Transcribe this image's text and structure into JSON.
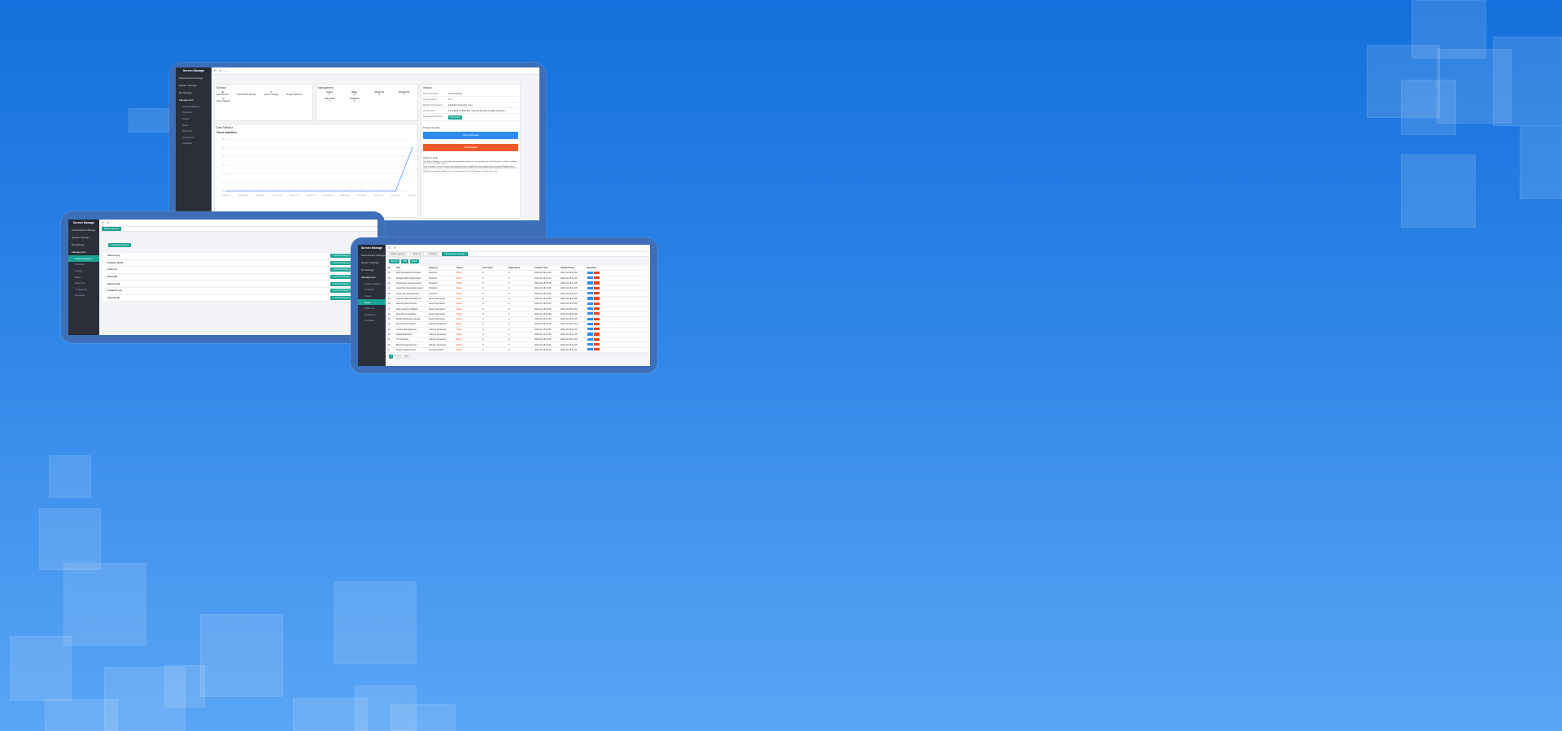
{
  "app": {
    "title": "Screen Manage"
  },
  "sidebar": {
    "items": [
      "Administrator Manage",
      "System Settings",
      "My Settings",
      "Management"
    ],
    "sub_items": [
      "Article Category",
      "Products",
      "Cases",
      "News",
      "About Us",
      "Contact Us",
      "Carousel"
    ]
  },
  "dashboard": {
    "shortcuts_title": "Shortcut",
    "shortcuts": [
      "Data Statistics",
      "Administrator Manage",
      "System Settings",
      "Change password",
      "Article Category"
    ],
    "management_title": "Management",
    "management": [
      {
        "label": "Cases",
        "count": "0"
      },
      {
        "label": "News",
        "count": "24"
      },
      {
        "label": "About Us",
        "count": "0"
      },
      {
        "label": "Contact Us",
        "count": "0"
      },
      {
        "label": "Carousels",
        "count": "3"
      },
      {
        "label": "Products",
        "count": "8"
      }
    ],
    "stats_title": "Data Statistics",
    "chart_title": "Views statistics",
    "info": {
      "title": "Version",
      "rows": [
        {
          "k": "Framework Name",
          "v": "Screen Manage"
        },
        {
          "k": "Current Version",
          "v": "v1.0"
        },
        {
          "k": "Method of Framework",
          "v": "FastAdmin framework, layui"
        },
        {
          "k": "Use Scenario",
          "v": "It is suitable for B2B, B2C, O2O and all kinds of related enterprise..."
        },
        {
          "k": "Development Channel",
          "v": "View Detail"
        }
      ]
    },
    "buttons": {
      "download": "Online Download",
      "update": "Check Update"
    },
    "product_title": "Product Update",
    "author_title": "Author's Note",
    "author_text": [
      "This Screen Manage is a multi-platform management system for serving enterprises and developers, reducing repetitive work and accelerating projects.",
      "Thus, it supports Screen Manage, a management system suitable for various applications, including Website admin system, Business system, Content Management System (CMS), Customer Relationship Management (CRM) and more.",
      "Whether for enterprise applications or personal projects, Screen Manage can meet your needs."
    ]
  },
  "chart_data": {
    "type": "line",
    "title": "Views statistics",
    "x": [
      "2023-10-12",
      "2023-10-13",
      "2023-10-14",
      "2023-10-15",
      "2023-10-16",
      "2023-10-17",
      "2023-10-18",
      "2023-10-19",
      "2023-10-20",
      "2023-10-21",
      "2023-10-22",
      "2023-10-23"
    ],
    "series": [
      {
        "values": [
          0,
          0,
          0,
          0,
          0,
          0,
          0,
          0,
          0,
          0,
          0,
          10
        ]
      }
    ],
    "ylim": [
      0,
      12
    ]
  },
  "category_page": {
    "tab": "Article Category",
    "add_button": "+ Add New Category",
    "rows": [
      "About Us (1)",
      "Products (2) (8)",
      "Cases (4)",
      "News (24)",
      "About Us (0)",
      "Contact Us (0)",
      "Carousel (3)"
    ],
    "row_actions": [
      "+ Add Subcategory",
      "Edit",
      "Delete"
    ]
  },
  "table_page": {
    "tabs": [
      "Article Category",
      "About Us",
      "Products",
      "Administrator Manage"
    ],
    "toolbar": [
      "Refresh",
      "Add",
      "Delete"
    ],
    "columns": [
      "ID",
      "Title",
      "Category",
      "Status",
      "Sort Order",
      "Page Views",
      "Created Time",
      "Updated Time",
      "Operation"
    ],
    "rows": [
      [
        "24",
        "MVP Development Project",
        "Products",
        "Show",
        "0",
        "0",
        "2023-10-18 14:20",
        "2023-10-18 14:20"
      ],
      [
        "23",
        "Website SEO Optimization",
        "Products",
        "Show",
        "0",
        "0",
        "2023-10-18 14:10",
        "2023-10-18 14:10"
      ],
      [
        "22",
        "Technology Service Center",
        "Products",
        "Show",
        "0",
        "0",
        "2023-10-18 14:08",
        "2023-10-18 14:08"
      ],
      [
        "21",
        "Cloud Solutions Deployment",
        "Products",
        "Show",
        "0",
        "0",
        "2023-10-18 14:05",
        "2023-10-18 14:05"
      ],
      [
        "20",
        "Smart App Development",
        "Products",
        "Show",
        "0",
        "0",
        "2023-10-18 14:00",
        "2023-10-18 14:00"
      ],
      [
        "19",
        "Custom Web Development",
        "News Information",
        "Show",
        "0",
        "0",
        "2023-10-18 13:58",
        "2023-10-18 13:58"
      ],
      [
        "18",
        "Security Audit Service",
        "News Information",
        "Show",
        "0",
        "0",
        "2023-10-18 13:55",
        "2023-10-18 13:55"
      ],
      [
        "17",
        "Data Analytics Platform",
        "News Information",
        "Show",
        "0",
        "0",
        "2023-10-18 13:50",
        "2023-10-18 13:50"
      ],
      [
        "16",
        "Enterprise Integration",
        "News Information",
        "Show",
        "0",
        "0",
        "2023-10-18 13:48",
        "2023-10-18 13:48"
      ],
      [
        "15",
        "Mobile Application Design",
        "News Information",
        "Show",
        "0",
        "0",
        "2023-10-18 13:45",
        "2023-10-18 13:45"
      ],
      [
        "14",
        "E-Commerce System",
        "Industry Dynamics",
        "Show",
        "0",
        "0",
        "2023-10-18 13:40",
        "2023-10-18 13:40"
      ],
      [
        "13",
        "Content Management",
        "Industry Dynamics",
        "Show",
        "0",
        "0",
        "2023-10-18 13:38",
        "2023-10-18 13:38"
      ],
      [
        "12",
        "Digital Marketing",
        "Industry Dynamics",
        "Show",
        "0",
        "0",
        "2023-10-18 13:35",
        "2023-10-18 13:35"
      ],
      [
        "11",
        "IT Consulting",
        "Industry Dynamics",
        "Show",
        "0",
        "0",
        "2023-10-18 13:30",
        "2023-10-18 13:30"
      ],
      [
        "10",
        "Brand Design Service",
        "Industry Dynamics",
        "Show",
        "0",
        "0",
        "2023-10-18 13:25",
        "2023-10-18 13:25"
      ],
      [
        "9",
        "System Maintenance",
        "Company News",
        "Show",
        "0",
        "0",
        "2023-10-18 13:20",
        "2023-10-18 13:20"
      ]
    ],
    "pagination": {
      "current": "1",
      "next": "2",
      "per_page": "10"
    },
    "ops": [
      "Edit",
      "Delete"
    ]
  }
}
